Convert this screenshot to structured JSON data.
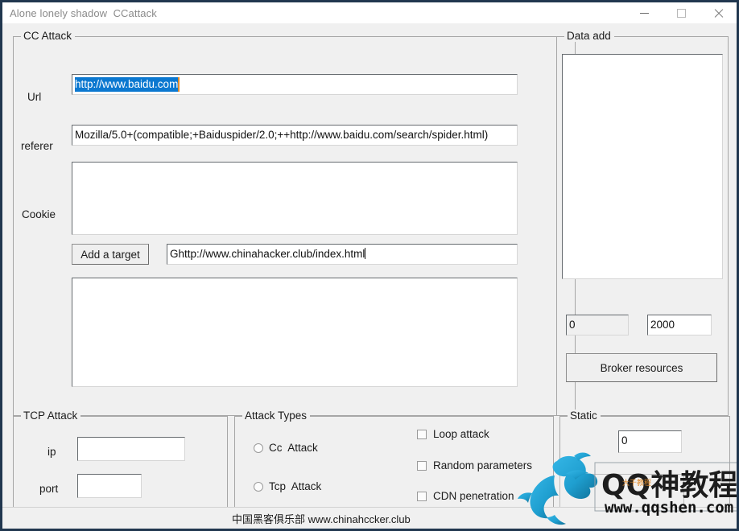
{
  "window": {
    "title": "Alone lonely shadow  CCattack",
    "controls": {
      "minimize": "minimize",
      "maximize": "maximize",
      "close": "close"
    }
  },
  "cc_attack": {
    "group_title": "CC Attack",
    "url_label": "Url",
    "url_value": "http://www.baidu.com",
    "url_selected": true,
    "referer_label": "referer",
    "referer_value": "Mozilla/5.0+(compatible;+Baiduspider/2.0;++http://www.baidu.com/search/spider.html)",
    "cookie_label": "Cookie",
    "cookie_value": "",
    "add_target_button": "Add a target",
    "target_value": "Ghttp://www.chinahacker.club/index.html",
    "target_list_value": ""
  },
  "data_add": {
    "group_title": "Data add",
    "list_value": "",
    "count_value": "0",
    "threads_value": "2000",
    "broker_button": "Broker resources"
  },
  "tcp_attack": {
    "group_title": "TCP Attack",
    "ip_label": "ip",
    "ip_value": "",
    "port_label": "port",
    "port_value": ""
  },
  "attack_types": {
    "group_title": "Attack Types",
    "radios": [
      {
        "label": "Cc  Attack",
        "checked": false
      },
      {
        "label": "Tcp  Attack",
        "checked": false
      }
    ],
    "checkboxes": [
      {
        "label": "Loop attack",
        "checked": false
      },
      {
        "label": "Random parameters",
        "checked": false
      },
      {
        "label": "CDN penetration",
        "checked": false
      }
    ]
  },
  "static": {
    "group_title": "Static",
    "counter_value": "0"
  },
  "statusbar": {
    "text": "中国黑客俱乐部 www.chinahccker.club"
  },
  "watermark": {
    "brand": "QQ神教程网",
    "url": "www.qqshen.com",
    "sub": "大千教程"
  },
  "colors": {
    "window_border": "#21374f",
    "client_bg": "#f0f0f0",
    "selection_blue": "#0b78d0",
    "caret_orange": "#e08a2a",
    "group_border": "#a6a6a6",
    "watermark_blue": "#1f9fd0"
  }
}
